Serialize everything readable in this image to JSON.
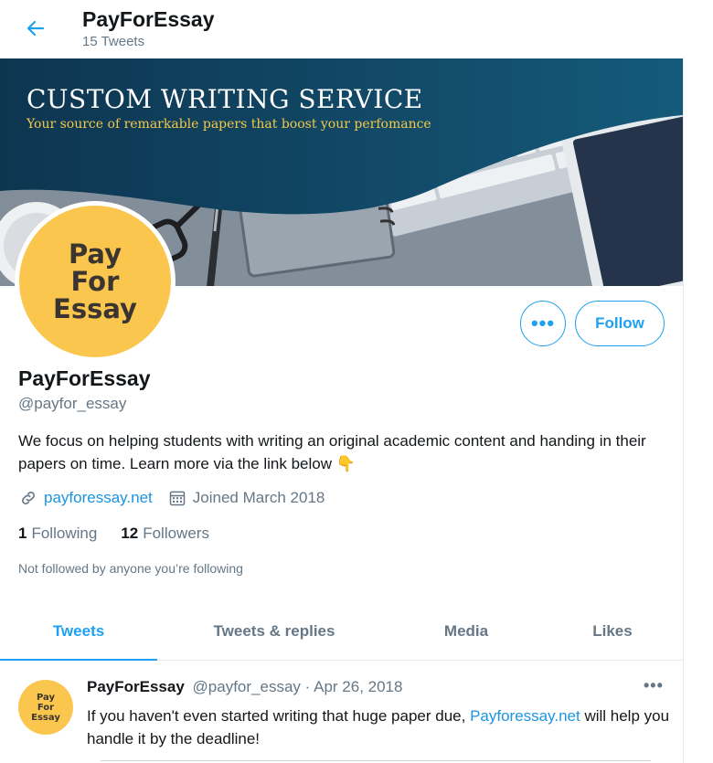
{
  "header": {
    "back_icon": "arrow-left-icon",
    "title": "PayForEssay",
    "tweet_count": "15 Tweets"
  },
  "banner": {
    "title": "CUSTOM WRITING SERVICE",
    "subtitle": "Your source of remarkable papers that boost your perfomance"
  },
  "avatar": {
    "text": "Pay\nFor\nEssay"
  },
  "actions": {
    "more_label": "•••",
    "follow_label": "Follow"
  },
  "profile": {
    "name": "PayForEssay",
    "handle": "@payfor_essay",
    "bio": "We focus on helping students with writing an original academic content and handing in their papers on time. Learn more via the link below",
    "bio_emoji": "👇",
    "website": "payforessay.net",
    "joined": "Joined March 2018",
    "following_count": "1",
    "following_label": "Following",
    "followers_count": "12",
    "followers_label": "Followers",
    "not_followed": "Not followed by anyone you’re following"
  },
  "tabs": [
    {
      "label": "Tweets",
      "active": true
    },
    {
      "label": "Tweets & replies",
      "active": false
    },
    {
      "label": "Media",
      "active": false
    },
    {
      "label": "Likes",
      "active": false
    }
  ],
  "tweet": {
    "avatar_text": "Pay\nFor\nEssay",
    "name": "PayForEssay",
    "handle": "@payfor_essay",
    "separator": "·",
    "date": "Apr 26, 2018",
    "more": "•••",
    "text_before": "If you haven't even started writing that huge paper due, ",
    "link": "Payforessay.net",
    "text_after": " will help you handle it by the deadline!"
  },
  "colors": {
    "accent": "#1da1f2",
    "link": "#1b95e0",
    "muted": "#657786",
    "avatar_yellow": "#fbc64e",
    "banner_dark": "#0e3a55"
  }
}
